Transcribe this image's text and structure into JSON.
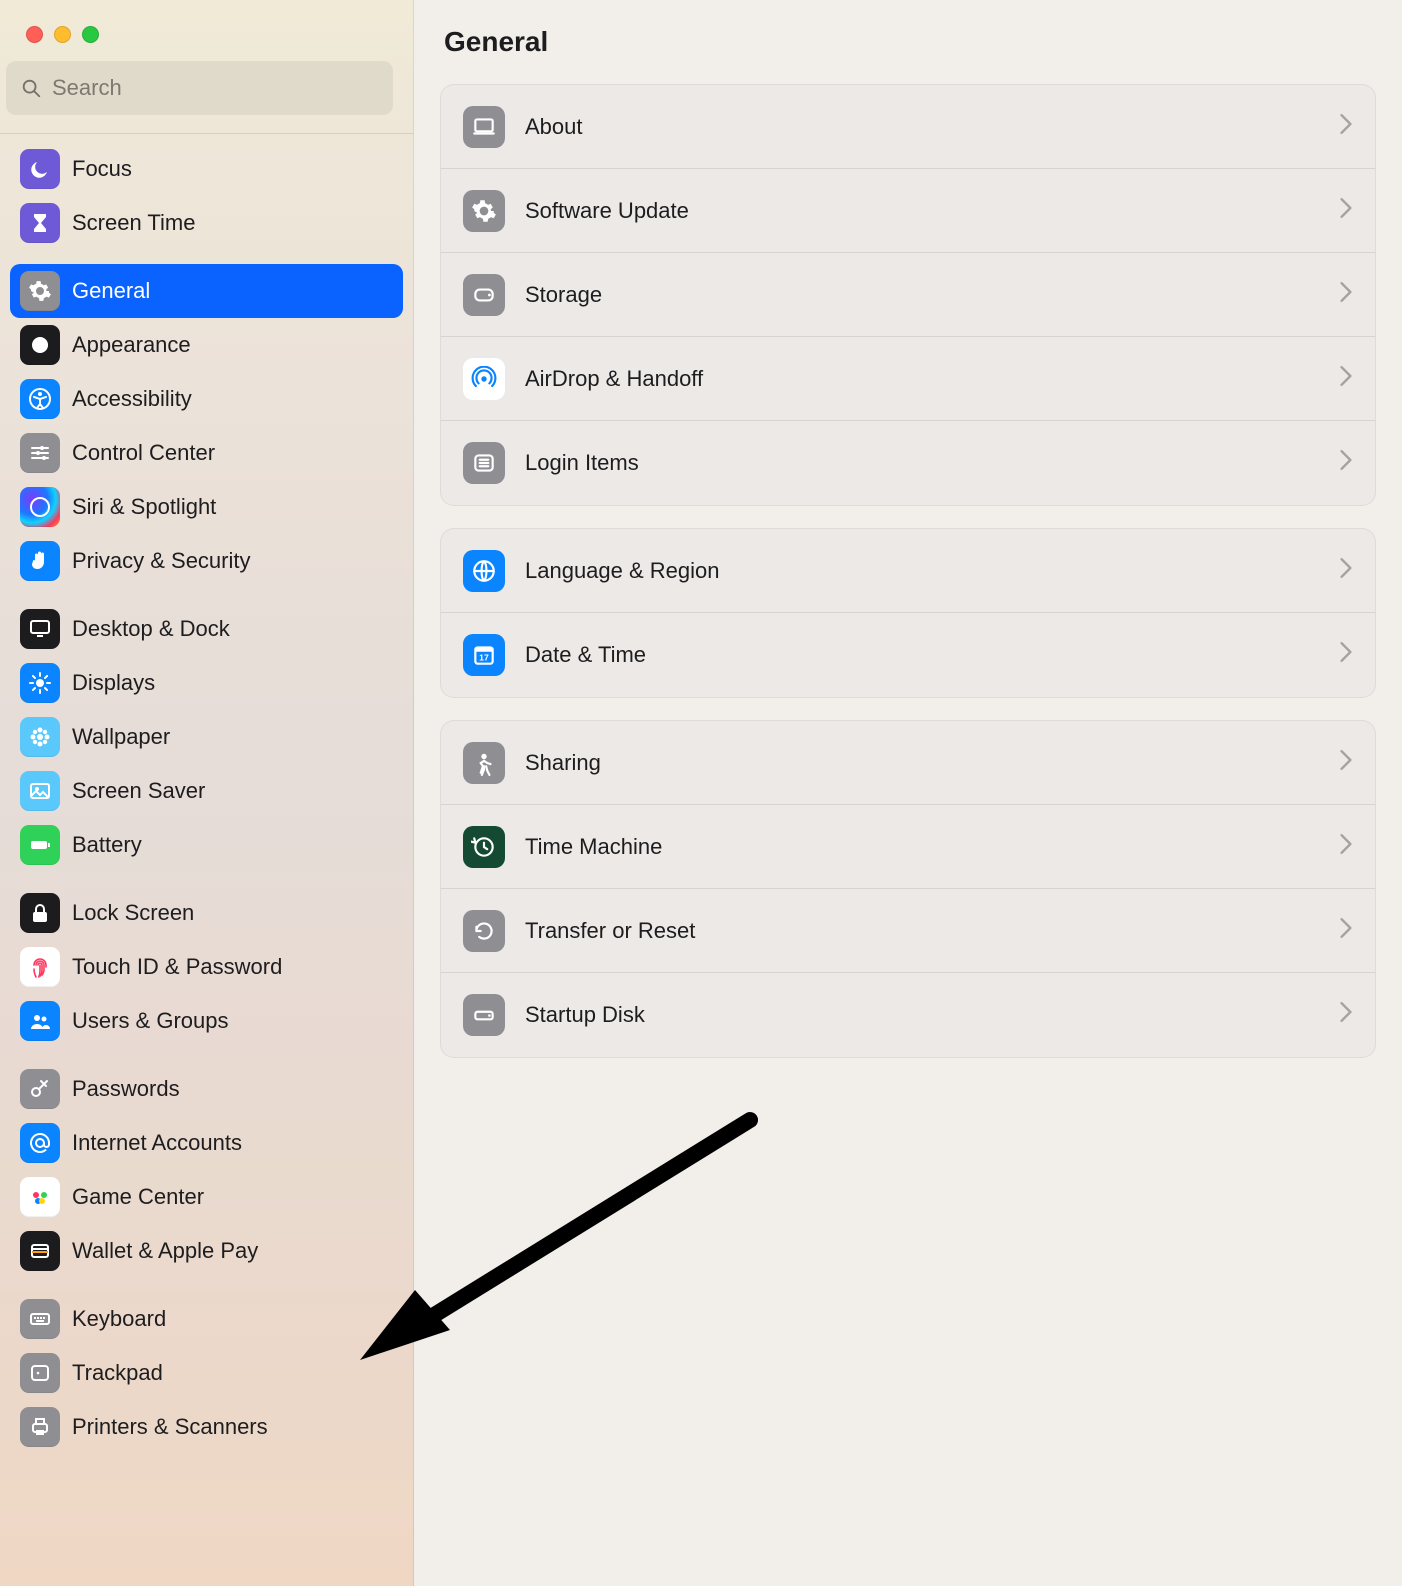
{
  "window": {
    "title": "General",
    "search_placeholder": "Search"
  },
  "sidebar": {
    "selected_id": "general",
    "items": [
      {
        "id": "focus",
        "label": "Focus",
        "icon": "moon-icon",
        "icon_class": "ic-focus",
        "spacer_before": false
      },
      {
        "id": "screen-time",
        "label": "Screen Time",
        "icon": "hourglass-icon",
        "icon_class": "ic-screen-time",
        "spacer_before": false
      },
      {
        "id": "general",
        "label": "General",
        "icon": "gear-icon",
        "icon_class": "ic-general",
        "spacer_before": true
      },
      {
        "id": "appearance",
        "label": "Appearance",
        "icon": "appearance-icon",
        "icon_class": "ic-appearance",
        "spacer_before": false
      },
      {
        "id": "accessibility",
        "label": "Accessibility",
        "icon": "accessibility-icon",
        "icon_class": "ic-accessibility",
        "spacer_before": false
      },
      {
        "id": "control-center",
        "label": "Control Center",
        "icon": "sliders-icon",
        "icon_class": "ic-control-center",
        "spacer_before": false
      },
      {
        "id": "siri-spotlight",
        "label": "Siri & Spotlight",
        "icon": "siri-icon",
        "icon_class": "ic-siri",
        "spacer_before": false
      },
      {
        "id": "privacy",
        "label": "Privacy & Security",
        "icon": "hand-icon",
        "icon_class": "ic-privacy",
        "spacer_before": false
      },
      {
        "id": "desktop-dock",
        "label": "Desktop & Dock",
        "icon": "desktop-icon",
        "icon_class": "ic-desktop",
        "spacer_before": true
      },
      {
        "id": "displays",
        "label": "Displays",
        "icon": "sun-icon",
        "icon_class": "ic-displays",
        "spacer_before": false
      },
      {
        "id": "wallpaper",
        "label": "Wallpaper",
        "icon": "flower-icon",
        "icon_class": "ic-wallpaper",
        "spacer_before": false
      },
      {
        "id": "screensaver",
        "label": "Screen Saver",
        "icon": "photo-icon",
        "icon_class": "ic-screensaver",
        "spacer_before": false
      },
      {
        "id": "battery",
        "label": "Battery",
        "icon": "battery-icon",
        "icon_class": "ic-battery",
        "spacer_before": false
      },
      {
        "id": "lock-screen",
        "label": "Lock Screen",
        "icon": "lock-icon",
        "icon_class": "ic-lock",
        "spacer_before": true
      },
      {
        "id": "touch-id",
        "label": "Touch ID & Password",
        "icon": "fingerprint-icon",
        "icon_class": "ic-touchid",
        "spacer_before": false
      },
      {
        "id": "users-groups",
        "label": "Users & Groups",
        "icon": "people-icon",
        "icon_class": "ic-users",
        "spacer_before": false
      },
      {
        "id": "passwords",
        "label": "Passwords",
        "icon": "key-icon",
        "icon_class": "ic-passwords",
        "spacer_before": true
      },
      {
        "id": "internet-accts",
        "label": "Internet Accounts",
        "icon": "at-icon",
        "icon_class": "ic-internet",
        "spacer_before": false
      },
      {
        "id": "game-center",
        "label": "Game Center",
        "icon": "gamecontroller-icon",
        "icon_class": "ic-gamecenter",
        "spacer_before": false
      },
      {
        "id": "wallet",
        "label": "Wallet & Apple Pay",
        "icon": "wallet-icon",
        "icon_class": "ic-wallet",
        "spacer_before": false
      },
      {
        "id": "keyboard",
        "label": "Keyboard",
        "icon": "keyboard-icon",
        "icon_class": "ic-keyboard",
        "spacer_before": true
      },
      {
        "id": "trackpad",
        "label": "Trackpad",
        "icon": "trackpad-icon",
        "icon_class": "ic-trackpad",
        "spacer_before": false
      },
      {
        "id": "printers",
        "label": "Printers & Scanners",
        "icon": "printer-icon",
        "icon_class": "ic-printers",
        "spacer_before": false
      }
    ]
  },
  "main": {
    "groups": [
      {
        "items": [
          {
            "id": "about",
            "label": "About",
            "icon": "laptop-icon",
            "icon_class": "ric-about"
          },
          {
            "id": "software",
            "label": "Software Update",
            "icon": "gear-badge-icon",
            "icon_class": "ric-software"
          },
          {
            "id": "storage",
            "label": "Storage",
            "icon": "disk-icon",
            "icon_class": "ric-storage"
          },
          {
            "id": "airdrop",
            "label": "AirDrop & Handoff",
            "icon": "airdrop-icon",
            "icon_class": "ric-airdrop"
          },
          {
            "id": "login",
            "label": "Login Items",
            "icon": "list-icon",
            "icon_class": "ric-login"
          }
        ]
      },
      {
        "items": [
          {
            "id": "language",
            "label": "Language & Region",
            "icon": "globe-icon",
            "icon_class": "ric-language"
          },
          {
            "id": "date",
            "label": "Date & Time",
            "icon": "calendar-icon",
            "icon_class": "ric-date"
          }
        ]
      },
      {
        "items": [
          {
            "id": "sharing",
            "label": "Sharing",
            "icon": "person-walk-icon",
            "icon_class": "ric-sharing"
          },
          {
            "id": "time-machine",
            "label": "Time Machine",
            "icon": "clock-arrow-icon",
            "icon_class": "ric-time-machine"
          },
          {
            "id": "transfer",
            "label": "Transfer or Reset",
            "icon": "undo-icon",
            "icon_class": "ric-transfer"
          },
          {
            "id": "startup",
            "label": "Startup Disk",
            "icon": "harddrive-icon",
            "icon_class": "ric-startup"
          }
        ]
      }
    ]
  },
  "annotation": {
    "arrow_points_to_item_id": "wallet"
  }
}
